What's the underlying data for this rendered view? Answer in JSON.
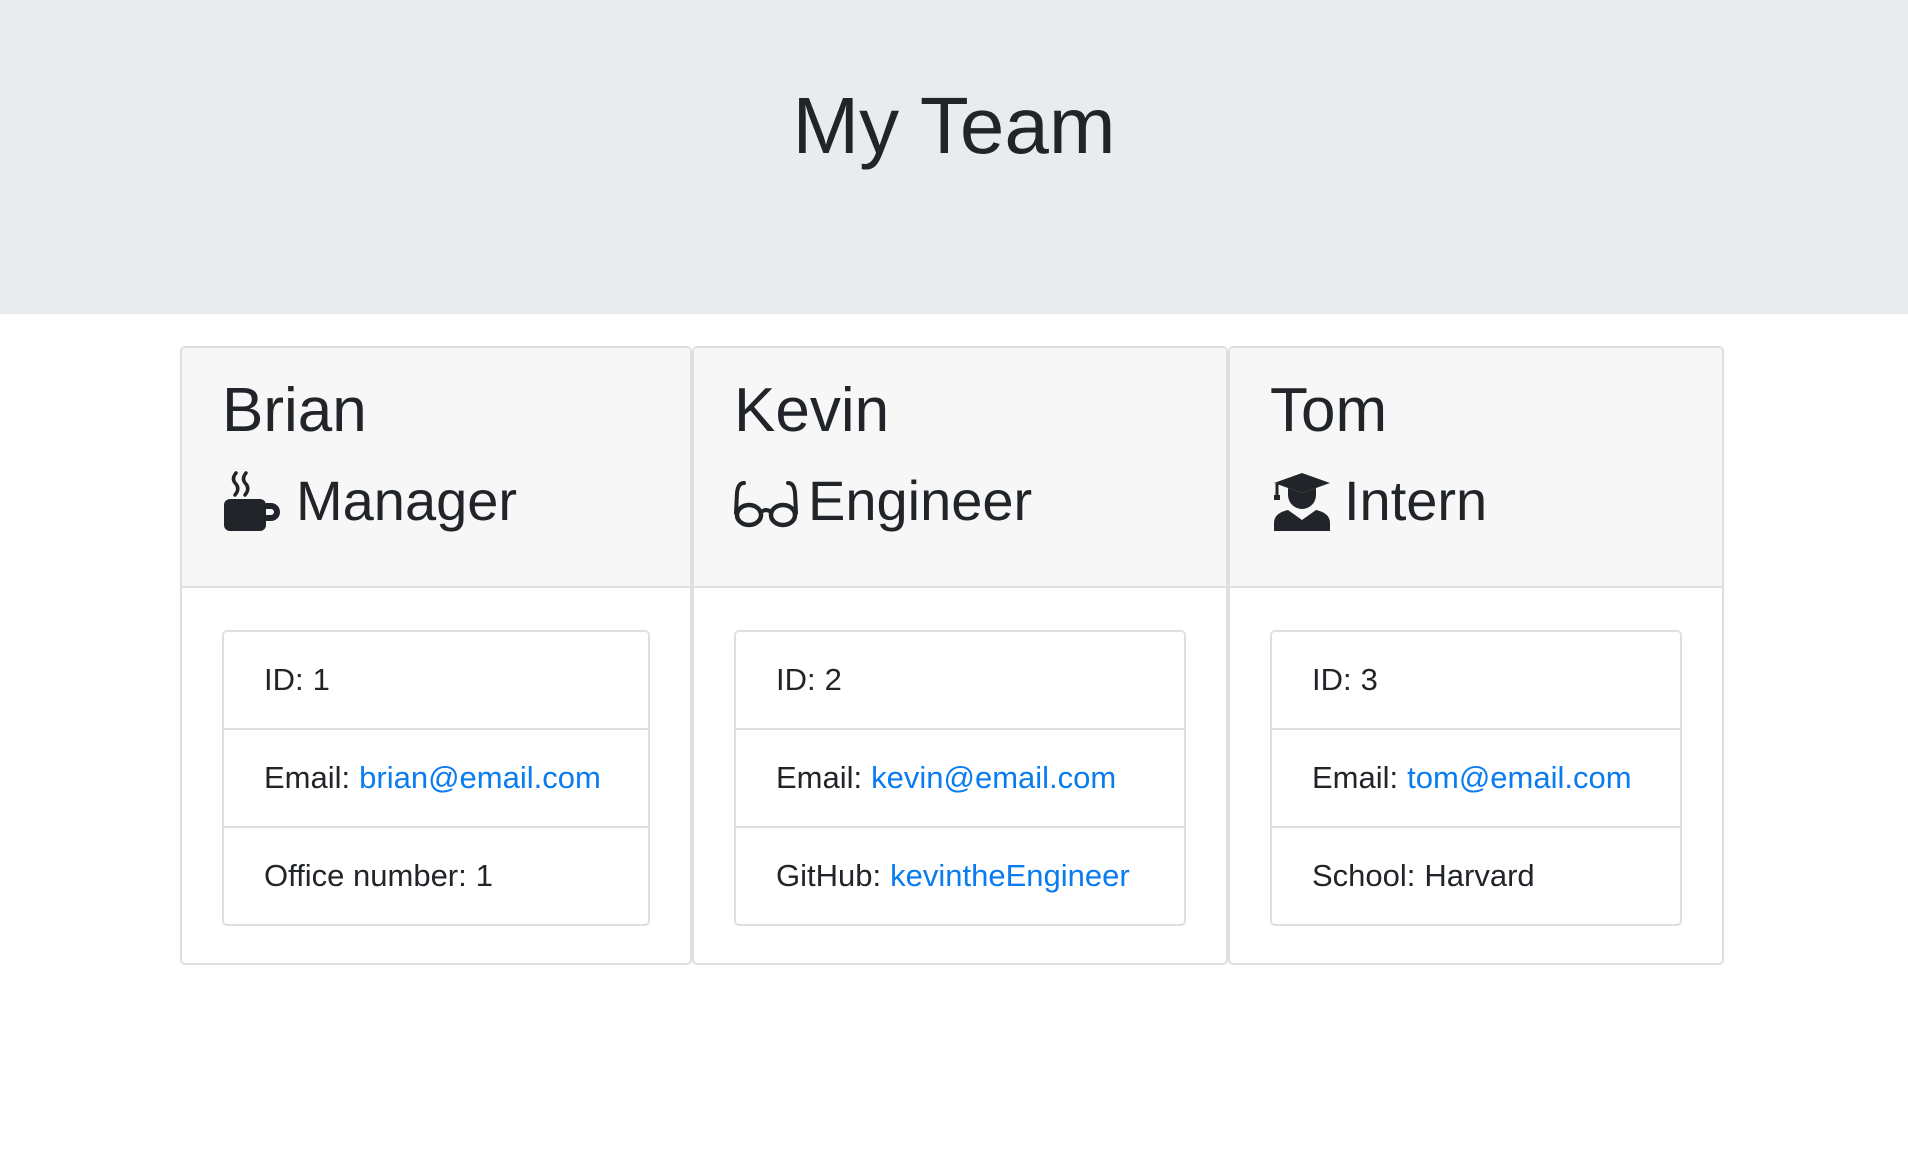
{
  "header": {
    "title": "My Team"
  },
  "colors": {
    "jumbotron_bg": "#e9ecef",
    "link": "#0a7cf0",
    "header_bg": "#f7f7f7"
  },
  "employees": [
    {
      "name": "Brian",
      "role": "Manager",
      "role_icon": "coffee-mug-icon",
      "id_label": "ID:",
      "id_value": "1",
      "email_label": "Email:",
      "email": "brian@email.com",
      "extra_label": "Office number:",
      "extra_value": "1"
    },
    {
      "name": "Kevin",
      "role": "Engineer",
      "role_icon": "glasses-icon",
      "id_label": "ID:",
      "id_value": "2",
      "email_label": "Email:",
      "email": "kevin@email.com",
      "extra_label": "GitHub:",
      "extra_value": "kevintheEngineer"
    },
    {
      "name": "Tom",
      "role": "Intern",
      "role_icon": "graduate-icon",
      "id_label": "ID:",
      "id_value": "3",
      "email_label": "Email:",
      "email": "tom@email.com",
      "extra_label": "School:",
      "extra_value": "Harvard"
    }
  ]
}
